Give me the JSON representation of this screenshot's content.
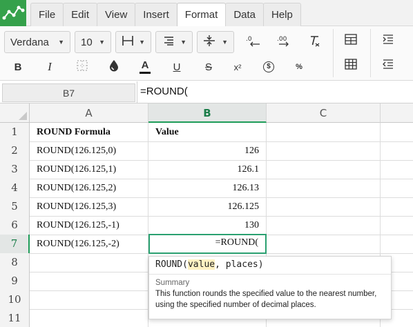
{
  "menus": [
    "File",
    "Edit",
    "View",
    "Insert",
    "Format",
    "Data",
    "Help"
  ],
  "active_menu": "Format",
  "toolbar": {
    "font_family": "Verdana",
    "font_size": "10",
    "icons": {
      "borders": "borders-icon",
      "align": "align-icon",
      "valign": "vertical-align-icon",
      "decrease_decimal": "decrease-decimal-icon",
      "increase_decimal": "increase-decimal-icon",
      "clear_format": "clear-format-icon",
      "bold": "bold-icon",
      "italic": "italic-icon",
      "cell_borders": "cell-borders-icon",
      "fill_color": "fill-color-icon",
      "text_color": "text-color-icon",
      "underline": "underline-icon",
      "strikethrough": "strikethrough-icon",
      "superscript": "superscript-icon",
      "currency": "currency-icon",
      "percent": "percent-icon",
      "table": "table-icon",
      "table_grid": "table-grid-icon",
      "indent": "indent-icon",
      "outdent": "outdent-icon"
    },
    "bold_label": "B",
    "italic_label": "I",
    "text_color_label": "A",
    "underline_label": "U",
    "strike_label": "S",
    "superscript_label": "x²",
    "currency_label": "$",
    "percent_label": "%",
    "clear_label": "T̸"
  },
  "formula_bar": {
    "cell_ref": "B7",
    "formula": "=ROUND("
  },
  "columns": [
    "A",
    "B",
    "C"
  ],
  "selected_column": "B",
  "rows": [
    {
      "n": "1",
      "a": "ROUND Formula",
      "b": "Value"
    },
    {
      "n": "2",
      "a": "ROUND(126.125,0)",
      "b": "126"
    },
    {
      "n": "3",
      "a": "ROUND(126.125,1)",
      "b": "126.1"
    },
    {
      "n": "4",
      "a": "ROUND(126.125,2)",
      "b": "126.13"
    },
    {
      "n": "5",
      "a": "ROUND(126.125,3)",
      "b": "126.125"
    },
    {
      "n": "6",
      "a": "ROUND(126.125,-1)",
      "b": "130"
    },
    {
      "n": "7",
      "a": "ROUND(126.125,-2)",
      "b": "=ROUND("
    },
    {
      "n": "8",
      "a": "",
      "b": ""
    },
    {
      "n": "9",
      "a": "",
      "b": ""
    },
    {
      "n": "10",
      "a": "",
      "b": ""
    },
    {
      "n": "11",
      "a": "",
      "b": ""
    }
  ],
  "tooltip": {
    "fn": "ROUND(",
    "arg1": "value",
    "rest": ", places)",
    "summary_label": "Summary",
    "description": "This function rounds the specified value to the nearest number, using the specified number of decimal places."
  },
  "colors": {
    "accent": "#1e9c58",
    "logo": "#35a14b"
  }
}
